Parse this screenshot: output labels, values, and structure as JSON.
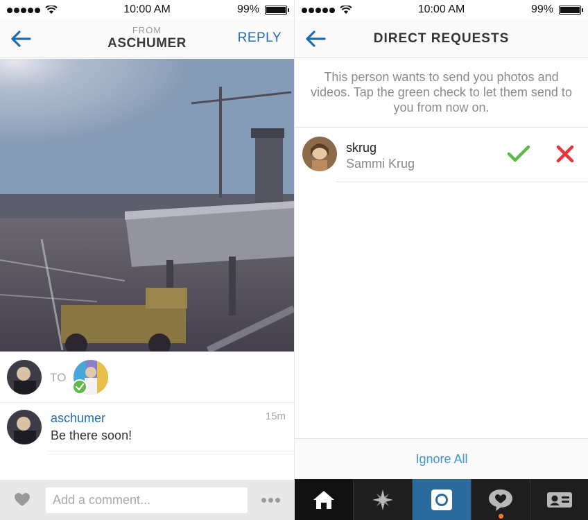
{
  "left": {
    "status": {
      "time": "10:00 AM",
      "battery": "99%"
    },
    "header": {
      "from_label": "FROM",
      "sender": "ASCHUMER",
      "reply_label": "REPLY"
    },
    "to_row": {
      "to_label": "TO"
    },
    "comment": {
      "username": "aschumer",
      "text": "Be there soon!",
      "time": "15m"
    },
    "comment_bar": {
      "placeholder": "Add a comment..."
    }
  },
  "right": {
    "status": {
      "time": "10:00 AM",
      "battery": "99%"
    },
    "header": {
      "title": "DIRECT REQUESTS"
    },
    "description": "This person wants to send you photos and videos. Tap the green check to let them send to you from now on.",
    "request": {
      "username": "skrug",
      "full_name": "Sammi Krug"
    },
    "ignore_all_label": "Ignore All",
    "tabbar": {
      "tabs": [
        "home-icon",
        "explore-icon",
        "camera-icon",
        "activity-icon",
        "profile-icon"
      ]
    }
  },
  "colors": {
    "link_blue": "#1f6bb0",
    "ignore_blue": "#3d97d8",
    "accept_green": "#5fb94a",
    "decline_red": "#e8323c",
    "camera_tab": "#2b6a9d",
    "notification": "#f07a30"
  }
}
